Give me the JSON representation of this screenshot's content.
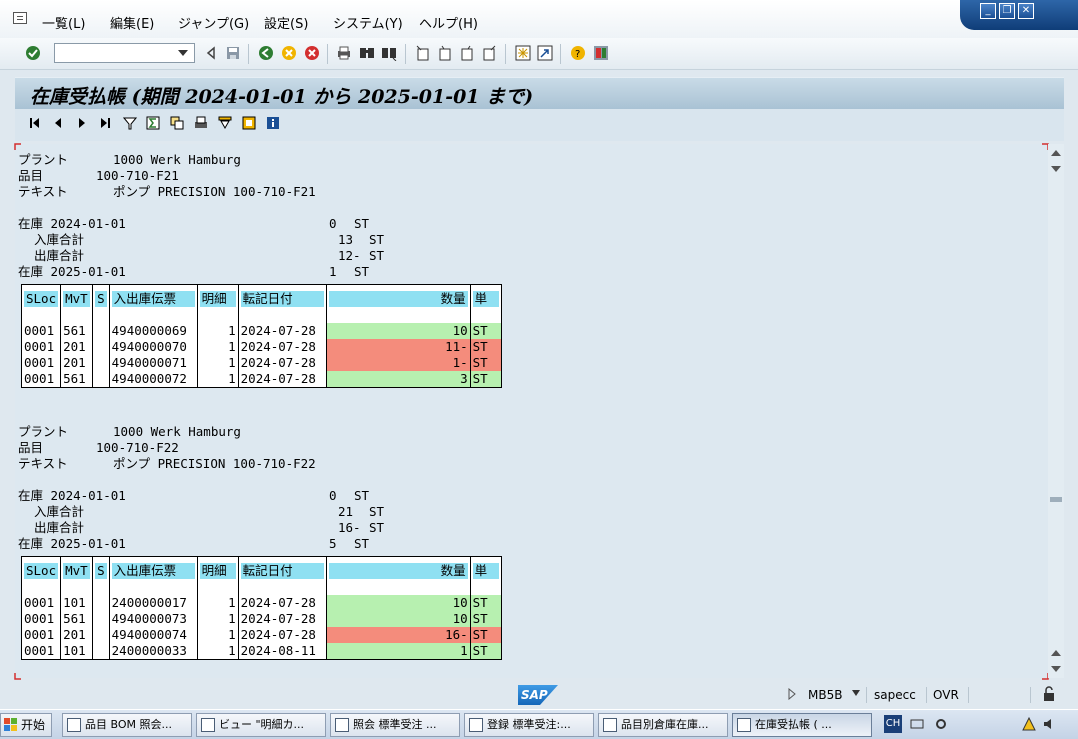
{
  "menu": {
    "items": [
      "一覧(L)",
      "編集(E)",
      "ジャンプ(G)",
      "設定(S)",
      "システム(Y)",
      "ヘルプ(H)"
    ]
  },
  "window_controls": {
    "minimize": "_",
    "restore": "❐",
    "close": "✕"
  },
  "toolbar": {
    "command_field_value": "",
    "icons": [
      "enter-icon",
      "save-icon",
      "back-icon",
      "exit-icon",
      "cancel-icon",
      "print-icon",
      "find-icon",
      "find-next-icon",
      "first-page-icon",
      "previous-page-icon",
      "next-page-icon",
      "last-page-icon",
      "new-session-icon",
      "shortcut-icon",
      "help-icon",
      "layout-icon"
    ]
  },
  "title": "在庫受払帳 (期間 2024-01-01 から 2025-01-01 まで)",
  "app_toolbar": {
    "icons": [
      "first-icon",
      "previous-icon",
      "next-icon",
      "last-icon",
      "filter-icon",
      "sum-icon",
      "details-icon",
      "print-icon",
      "filter-list-icon",
      "export-icon",
      "info-icon"
    ]
  },
  "blocks": [
    {
      "plant_label": "プラント",
      "plant_value": "1000 Werk Hamburg",
      "material_label": "品目",
      "material_value": "100-710-F21",
      "text_label": "テキスト",
      "text_value": "ポンプ PRECISION 100-710-F21",
      "stock_start_label": "在庫 2024-01-01",
      "stock_start_qty": "0",
      "stock_start_unit": "ST",
      "receipts_label": "入庫合計",
      "receipts_qty": "13",
      "receipts_unit": "ST",
      "issues_label": "出庫合計",
      "issues_qty": "12-",
      "issues_unit": "ST",
      "stock_end_label": "在庫 2025-01-01",
      "stock_end_qty": "1",
      "stock_end_unit": "ST",
      "columns": [
        "SLoc",
        "MvT",
        "S",
        "入出庫伝票",
        "明細",
        "転記日付",
        "数量",
        "単"
      ],
      "rows": [
        {
          "sloc": "0001",
          "mvt": "561",
          "s": "",
          "doc": "4940000069",
          "item": "1",
          "date": "2024-07-28",
          "qty": "10",
          "unit": "ST",
          "neg": false
        },
        {
          "sloc": "0001",
          "mvt": "201",
          "s": "",
          "doc": "4940000070",
          "item": "1",
          "date": "2024-07-28",
          "qty": "11-",
          "unit": "ST",
          "neg": true
        },
        {
          "sloc": "0001",
          "mvt": "201",
          "s": "",
          "doc": "4940000071",
          "item": "1",
          "date": "2024-07-28",
          "qty": "1-",
          "unit": "ST",
          "neg": true
        },
        {
          "sloc": "0001",
          "mvt": "561",
          "s": "",
          "doc": "4940000072",
          "item": "1",
          "date": "2024-07-28",
          "qty": "3",
          "unit": "ST",
          "neg": false
        }
      ]
    },
    {
      "plant_label": "プラント",
      "plant_value": "1000 Werk Hamburg",
      "material_label": "品目",
      "material_value": "100-710-F22",
      "text_label": "テキスト",
      "text_value": "ポンプ PRECISION 100-710-F22",
      "stock_start_label": "在庫 2024-01-01",
      "stock_start_qty": "0",
      "stock_start_unit": "ST",
      "receipts_label": "入庫合計",
      "receipts_qty": "21",
      "receipts_unit": "ST",
      "issues_label": "出庫合計",
      "issues_qty": "16-",
      "issues_unit": "ST",
      "stock_end_label": "在庫 2025-01-01",
      "stock_end_qty": "5",
      "stock_end_unit": "ST",
      "columns": [
        "SLoc",
        "MvT",
        "S",
        "入出庫伝票",
        "明細",
        "転記日付",
        "数量",
        "単"
      ],
      "rows": [
        {
          "sloc": "0001",
          "mvt": "101",
          "s": "",
          "doc": "2400000017",
          "item": "1",
          "date": "2024-07-28",
          "qty": "10",
          "unit": "ST",
          "neg": false
        },
        {
          "sloc": "0001",
          "mvt": "561",
          "s": "",
          "doc": "4940000073",
          "item": "1",
          "date": "2024-07-28",
          "qty": "10",
          "unit": "ST",
          "neg": false
        },
        {
          "sloc": "0001",
          "mvt": "201",
          "s": "",
          "doc": "4940000074",
          "item": "1",
          "date": "2024-07-28",
          "qty": "16-",
          "unit": "ST",
          "neg": true
        },
        {
          "sloc": "0001",
          "mvt": "101",
          "s": "",
          "doc": "2400000033",
          "item": "1",
          "date": "2024-08-11",
          "qty": "1",
          "unit": "ST",
          "neg": false
        }
      ]
    }
  ],
  "status": {
    "sap_logo": "SAP",
    "transaction": "MB5B",
    "server": "sapecc",
    "mode": "OVR"
  },
  "taskbar": {
    "start": "开始",
    "tasks": [
      "品目 BOM 照会...",
      "ビュー \"明細カ...",
      "照会 標準受注 ...",
      "登録 標準受注:...",
      "品目別倉庫在庫...",
      "在庫受払帳 ( ..."
    ],
    "tray": "CH"
  },
  "colors": {
    "header_cell": "#8fe0f2",
    "qty_positive": "#b7f0b0",
    "qty_negative": "#f48c7c",
    "title_bg": "#b8cfdf"
  }
}
